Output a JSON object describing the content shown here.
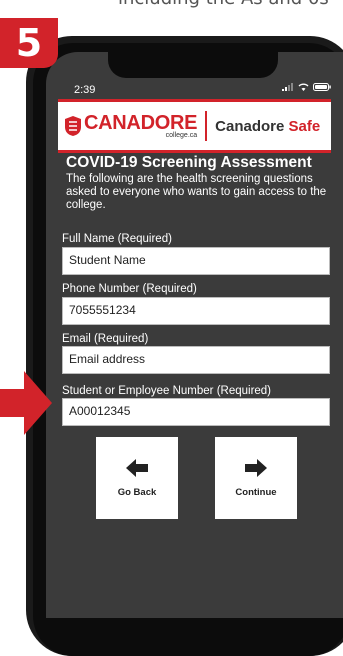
{
  "caption": "including the As and 0s",
  "step_number": "5",
  "status": {
    "time": "2:39"
  },
  "brand": {
    "logo_name": "CANADORE",
    "logo_sub": "college.ca",
    "app_title": "Canadore",
    "app_title_accent": "Safe",
    "accent_color": "#d2232a"
  },
  "form": {
    "title": "COVID-19 Screening Assessment",
    "intro": "The following are the health screening questions asked to everyone who wants to gain access to the college.",
    "fields": [
      {
        "label": "Full Name (Required)",
        "value": "Student Name"
      },
      {
        "label": "Phone Number (Required)",
        "value": "7055551234"
      },
      {
        "label": "Email (Required)",
        "value": "Email address"
      },
      {
        "label": "Student or Employee Number (Required)",
        "value": "A00012345"
      }
    ],
    "back_label": "Go Back",
    "continue_label": "Continue"
  }
}
